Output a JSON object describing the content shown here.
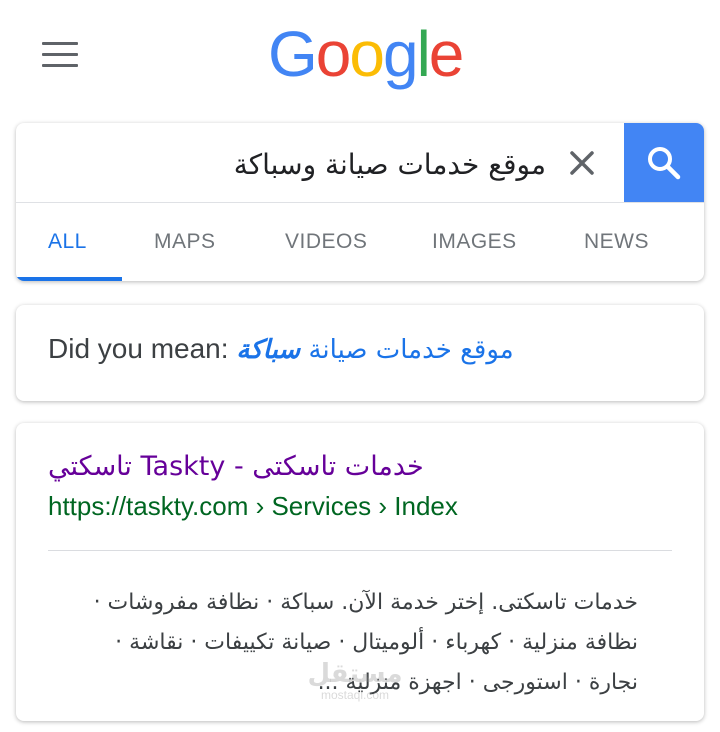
{
  "header": {
    "logo_letters": [
      "G",
      "o",
      "o",
      "g",
      "l",
      "e"
    ]
  },
  "search": {
    "query": "موقع خدمات صيانة وسباكة"
  },
  "tabs": [
    {
      "label": "ALL",
      "active": true
    },
    {
      "label": "MAPS",
      "active": false
    },
    {
      "label": "VIDEOS",
      "active": false
    },
    {
      "label": "IMAGES",
      "active": false
    },
    {
      "label": "NEWS",
      "active": false
    }
  ],
  "did_you_mean": {
    "prefix": "Did you mean:",
    "suggestion_normal": "موقع خدمات صيانة",
    "suggestion_bold": "سباكة"
  },
  "result": {
    "title": "خدمات تاسكتى - Taskty تاسكتي",
    "url": "https://taskty.com › Services › Index",
    "snippet_lines": [
      "خدمات تاسكتى. إختر خدمة الآن. سباكة · نظافة مفروشات ·",
      "نظافة منزلية · كهرباء · ألوميتال · صيانة تكييفات · نقاشة ·",
      "نجارة · استورجى · اجهزة منزلية ..."
    ]
  },
  "watermark": {
    "logo": "مستقل",
    "text": "mostaql.com"
  },
  "colors": {
    "accent_blue": "#4285f4",
    "tab_active": "#1a73e8",
    "visited_link": "#660099",
    "url_green": "#006621"
  }
}
